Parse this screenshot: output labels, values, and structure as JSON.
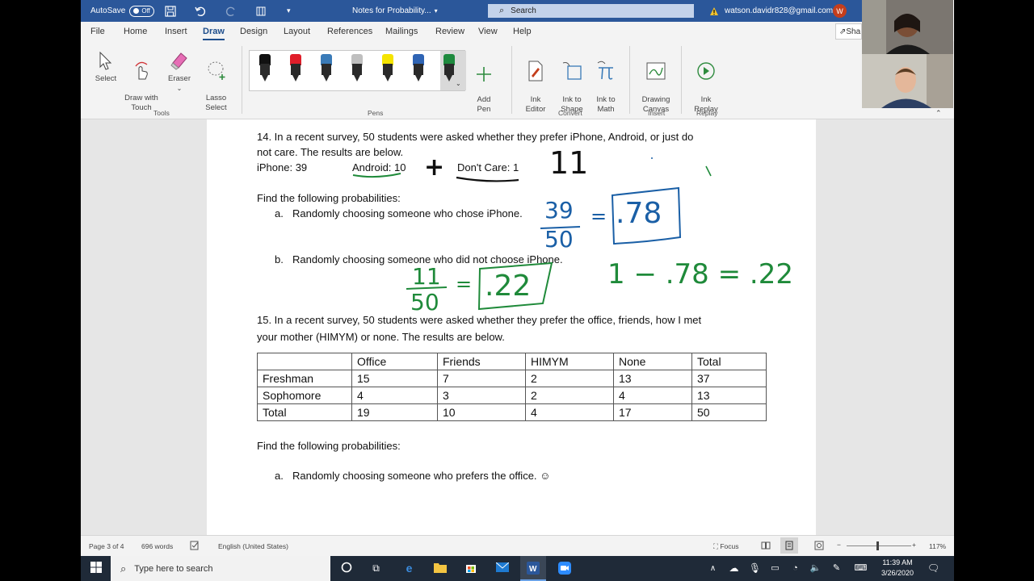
{
  "titlebar": {
    "autosave_label": "AutoSave",
    "autosave_state": "Off",
    "doc_title": "Notes for Probability...",
    "search_label": "Search",
    "account_email": "watson.davidr828@gmail.com",
    "account_initial": "W"
  },
  "menu": {
    "items": [
      "File",
      "Home",
      "Insert",
      "Draw",
      "Design",
      "Layout",
      "References",
      "Mailings",
      "Review",
      "View",
      "Help"
    ],
    "active": "Draw",
    "share_label": "Sha"
  },
  "ribbon": {
    "select": "Select",
    "draw_with_touch": "Draw with\nTouch",
    "eraser": "Eraser",
    "lasso_select": "Lasso\nSelect",
    "add_pen": "Add\nPen",
    "ink_editor": "Ink\nEditor",
    "ink_to_shape": "Ink to\nShape",
    "ink_to_math": "Ink to\nMath",
    "drawing_canvas": "Drawing\nCanvas",
    "ink_replay": "Ink\nReplay",
    "groups": {
      "tools": "Tools",
      "pens": "Pens",
      "convert": "Convert",
      "insert": "Insert",
      "replay": "Replay"
    },
    "pen_colors": [
      "#111111",
      "#e01e2a",
      "#3a7bb8",
      "#bfbfbf",
      "#f5e400",
      "#2f64b4",
      "#1e8a3e"
    ]
  },
  "document": {
    "q14_line1": "14. In a recent survey, 50 students were asked whether they prefer iPhone, Android, or just do",
    "q14_line2": "not care. The results are below.",
    "q14_iphone": "iPhone: 39",
    "q14_android": "Android: 10",
    "q14_dontcare": "Don't Care: 1",
    "find_probs": "Find the following probabilities:",
    "q14a_marker": "a.",
    "q14a_text": "Randomly choosing someone who chose iPhone.",
    "q14b_marker": "b.",
    "q14b_text": "Randomly choosing someone who did not choose iPhone.",
    "q15_line1": "15. In a recent survey, 50 students were asked whether they prefer the office, friends, how I met",
    "q15_line2": "your mother (HIMYM) or none. The results are below.",
    "table": {
      "headers": [
        "",
        "Office",
        "Friends",
        "HIMYM",
        "None",
        "Total"
      ],
      "rows": [
        [
          "Freshman",
          "15",
          "7",
          "2",
          "13",
          "37"
        ],
        [
          "Sophomore",
          "4",
          "3",
          "2",
          "4",
          "13"
        ],
        [
          "Total",
          "19",
          "10",
          "4",
          "17",
          "50"
        ]
      ]
    },
    "find_probs2": "Find the following probabilities:",
    "q15a_marker": "a.",
    "q15a_text": "Randomly choosing someone who prefers the office. ☺"
  },
  "ink": {
    "plus": "+",
    "eleven": "11",
    "frac_39_num": "39",
    "frac_39_den": "50",
    "eq1": "=",
    "answer_78": ".78",
    "frac_11_num": "11",
    "frac_11_den": "50",
    "eq2": "=",
    "answer_22": ".22",
    "complement": "1 − .78 = .22",
    "blue_color": "#1a5fa6",
    "green_color": "#1f8a3a"
  },
  "statusbar": {
    "page": "Page 3 of 4",
    "words": "696 words",
    "language": "English (United States)",
    "focus": "Focus",
    "zoom": "117%"
  },
  "taskbar": {
    "search_placeholder": "Type here to search",
    "time": "11:39 AM",
    "date": "3/26/2020"
  }
}
